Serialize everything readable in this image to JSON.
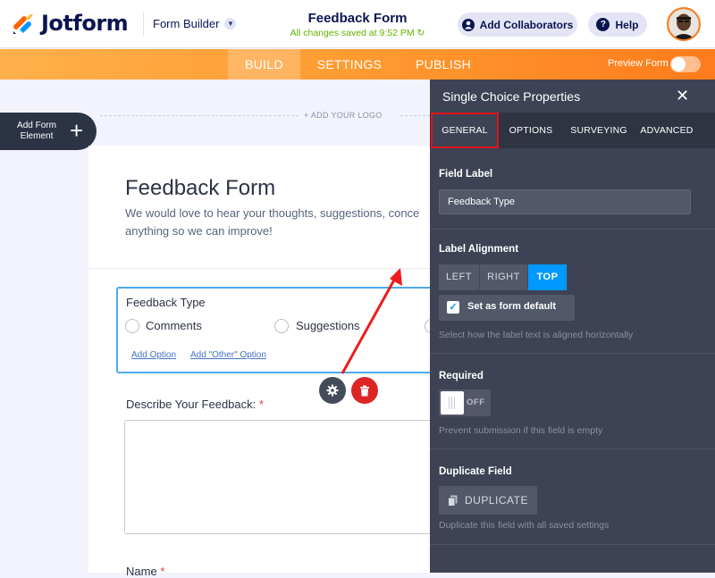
{
  "app": {
    "brand": "Jotform",
    "builder_menu": "Form Builder",
    "form_title": "Feedback Form",
    "save_status": "All changes saved at 9:52 PM",
    "collaborators_label": "Add Collaborators",
    "help_label": "Help"
  },
  "nav": {
    "tabs": [
      "BUILD",
      "SETTINGS",
      "PUBLISH"
    ],
    "active_tab": "BUILD",
    "preview_label": "Preview Form",
    "preview_on": false
  },
  "builder": {
    "add_element_label": "Add Form Element",
    "add_logo": "+ ADD YOUR LOGO"
  },
  "form": {
    "heading": "Feedback Form",
    "subheading_line1": "We would love to hear your thoughts, suggestions, conce",
    "subheading_line2": "anything so we can improve!",
    "question": {
      "label": "Feedback Type",
      "options": [
        "Comments",
        "Suggestions"
      ],
      "add_option": "Add Option",
      "add_other_option": "Add \"Other\" Option"
    },
    "describe_label": "Describe Your Feedback:",
    "name_label": "Name",
    "required_mark": "*"
  },
  "panel": {
    "title": "Single Choice Properties",
    "tabs": [
      "GENERAL",
      "OPTIONS",
      "SURVEYING",
      "ADVANCED"
    ],
    "active_tab": "GENERAL",
    "field_label_title": "Field Label",
    "field_label_value": "Feedback Type",
    "label_alignment_title": "Label Alignment",
    "alignments": [
      "LEFT",
      "RIGHT",
      "TOP"
    ],
    "active_alignment": "TOP",
    "set_default_label": "Set as form default",
    "set_default_checked": true,
    "alignment_hint": "Select how the label text is aligned horizontally",
    "required_title": "Required",
    "required_state": "OFF",
    "required_hint": "Prevent submission if this field is empty",
    "duplicate_title": "Duplicate Field",
    "duplicate_button": "DUPLICATE",
    "duplicate_hint": "Duplicate this field with all saved settings"
  },
  "colors": {
    "brand_navy": "#0a1551",
    "accent_orange": "#ff7b1c",
    "panel_bg": "#3d4354",
    "active_blue": "#0099ff",
    "highlight_red": "#e3131a",
    "delete_red": "#dc2626",
    "saved_green": "#64b200"
  }
}
